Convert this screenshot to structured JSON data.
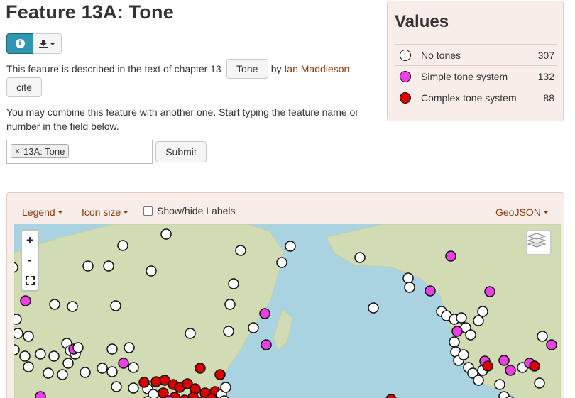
{
  "page": {
    "title": "Feature 13A: Tone",
    "description_prefix": "This feature is described in the text of chapter 13",
    "chapter_button": "Tone",
    "by_text": "by",
    "author": "Ian Maddieson",
    "cite_button": "cite",
    "combine_text": "You may combine this feature with another one. Start typing the feature name or number in the field below.",
    "tag_label": "13A: Tone",
    "tag_remove": "×",
    "submit_button": "Submit",
    "info_icon_glyph": "i"
  },
  "values": {
    "title": "Values",
    "items": [
      {
        "label": "No tones",
        "count": "307",
        "color": "#ffffff"
      },
      {
        "label": "Simple tone system",
        "count": "132",
        "color": "#ee3ee6"
      },
      {
        "label": "Complex tone system",
        "count": "88",
        "color": "#d90000"
      }
    ]
  },
  "map_toolbar": {
    "legend": "Legend",
    "icon_size": "Icon size",
    "labels_toggle": "Show/hide Labels",
    "geojson": "GeoJSON"
  },
  "map_controls": {
    "zoom_in": "+",
    "zoom_out": "-"
  },
  "colors": {
    "accent": "#8b3a0e",
    "info_button": "#2f96b4",
    "panel_bg": "#f9ede9",
    "ocean": "#a9d3e0",
    "land": "#d2dcb4"
  }
}
